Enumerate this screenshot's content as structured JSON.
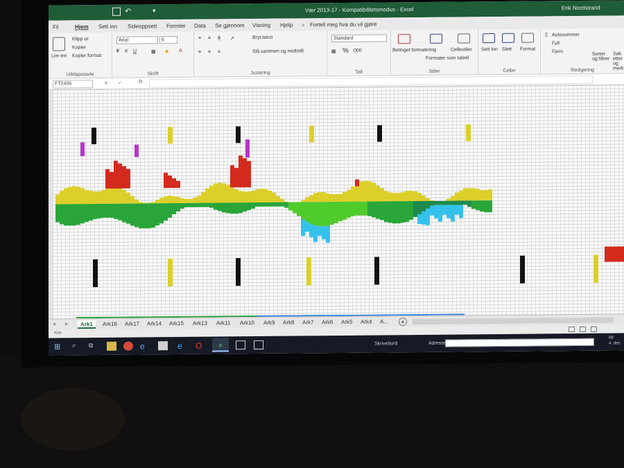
{
  "window": {
    "title": "Vær 2013-17  -  Kompatibilitetsmodus  -  Excel",
    "user": "Erik Nordstrand"
  },
  "ribbon_tabs": [
    "Fil",
    "Hjem",
    "Sett inn",
    "Sideoppsett",
    "Formler",
    "Data",
    "Se gjennom",
    "Visning",
    "Hjelp"
  ],
  "tell_me": "Fortell meg hva du vil gjøre",
  "ribbon": {
    "clipboard": {
      "paste": "Lim inn",
      "cut": "Klipp ut",
      "copy": "Kopier",
      "format_painter": "Kopier format",
      "label": "Utklippstavle"
    },
    "font": {
      "name": "Arial",
      "size": "6",
      "label": "Skrift"
    },
    "alignment": {
      "wrap": "Bryt tekst",
      "merge": "Slå sammen og midtstill",
      "label": "Justering"
    },
    "number": {
      "format": "Standard",
      "label": "Tall"
    },
    "styles": {
      "conditional": "Betinget formatering",
      "table": "Formater som tabell",
      "cell": "Cellestiler",
      "label": "Stiler"
    },
    "cells": {
      "insert": "Sett inn",
      "delete": "Slett",
      "format": "Format",
      "label": "Celler"
    },
    "editing": {
      "autosum": "Autosummer",
      "fill": "Fyll",
      "clear": "Fjern",
      "sort": "Sorter og filtrer",
      "find": "Søk etter og merk",
      "label": "Redigering"
    }
  },
  "formula_bar": {
    "name_box": "FT2406",
    "fx": "fx"
  },
  "sheets": [
    "Ark1",
    "Ark16",
    "Ark17",
    "Ark14",
    "Ark15",
    "Ark13",
    "Ark11",
    "Ark10",
    "Ark9",
    "Ark8",
    "Ark7",
    "Ark6",
    "Ark5",
    "Ark4",
    "A..."
  ],
  "active_sheet": "Ark1",
  "status": "Klar",
  "taskbar": {
    "desktop_label": "Skrivebord",
    "address_label": "Adresse",
    "time": "08",
    "date": "4. des."
  },
  "colors": {
    "red": "#d42a1e",
    "magenta": "#b535c8",
    "yellow": "#dccf2a",
    "light_green": "#4fcb2c",
    "green": "#2aa53a",
    "dark_green": "#1f8a4c",
    "cyan": "#35c2ea",
    "black": "#111111",
    "excel_green": "#1f5c38"
  },
  "icons": [
    "save-icon",
    "undo-icon",
    "search-icon",
    "windows-icon",
    "task-view-icon",
    "explorer-icon",
    "chrome-icon",
    "edge-icon",
    "opera-icon",
    "excel-icon"
  ]
}
